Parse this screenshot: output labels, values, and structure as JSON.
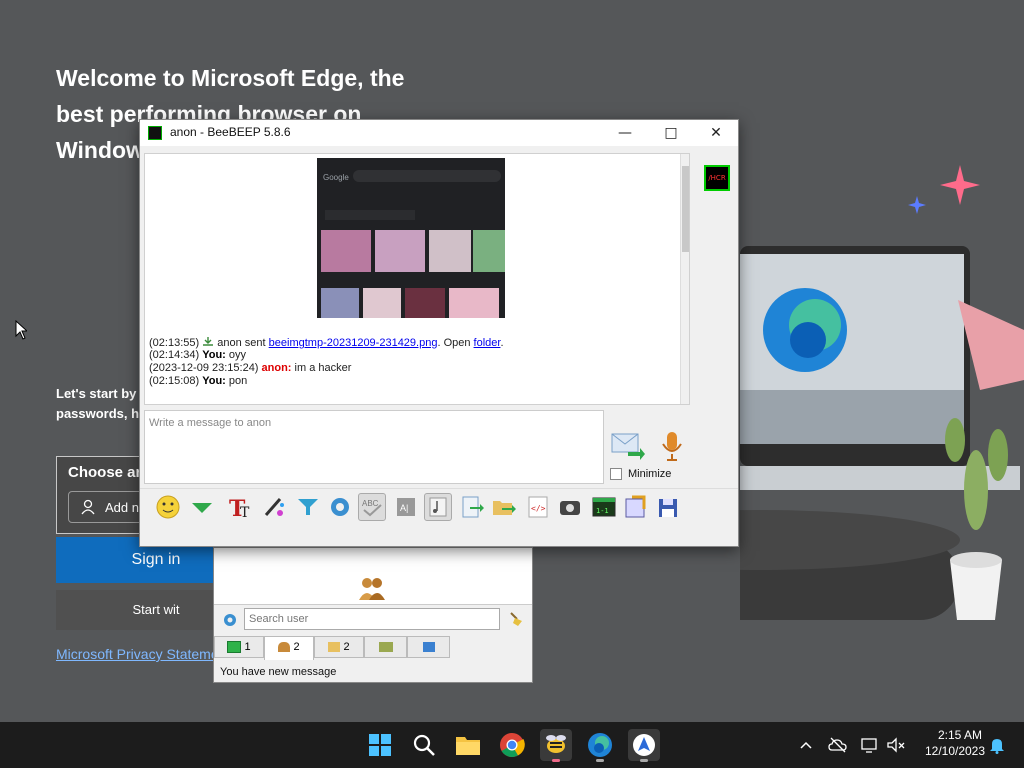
{
  "edge": {
    "title": "Welcome to Microsoft Edge, the best performing browser on Windows",
    "subtitle": "Let's start by passwords, h",
    "choose_label": "Choose ar",
    "add_label": "Add ne",
    "signin_label": "Sign in",
    "start_label": "Start wit",
    "privacy_link": "Microsoft Privacy Stateme"
  },
  "window": {
    "title": "anon - BeeBEEP 5.8.6"
  },
  "chat": {
    "messages": [
      {
        "time": "(02:13:55)",
        "prefix": "anon sent ",
        "link": "beeimgtmp-20231209-231429.png",
        "mid": ". Open ",
        "link2": "folder",
        "suffix": "."
      },
      {
        "time": "(02:14:34)",
        "sender": "You:",
        "text": "oyy"
      },
      {
        "time": "(2023-12-09 23:15:24)",
        "sender": "anon:",
        "text": "im a hacker"
      },
      {
        "time": "(02:15:08)",
        "sender": "You:",
        "text": "pon"
      }
    ],
    "compose_placeholder": "Write a message to anon",
    "minimize_label": "Minimize",
    "avatar_text": "/HCR"
  },
  "userlist": {
    "search_placeholder": "Search user",
    "tabs": [
      {
        "label": "1"
      },
      {
        "label": "2"
      },
      {
        "label": "2"
      },
      {
        "label": ""
      },
      {
        "label": ""
      }
    ],
    "status": "You have new message"
  },
  "taskbar": {
    "time": "2:15 AM",
    "date": "12/10/2023"
  },
  "colors": {
    "edge_blue": "#0f6cbd",
    "taskbar": "#1c1c1c",
    "other_sender": "#dd0000"
  }
}
